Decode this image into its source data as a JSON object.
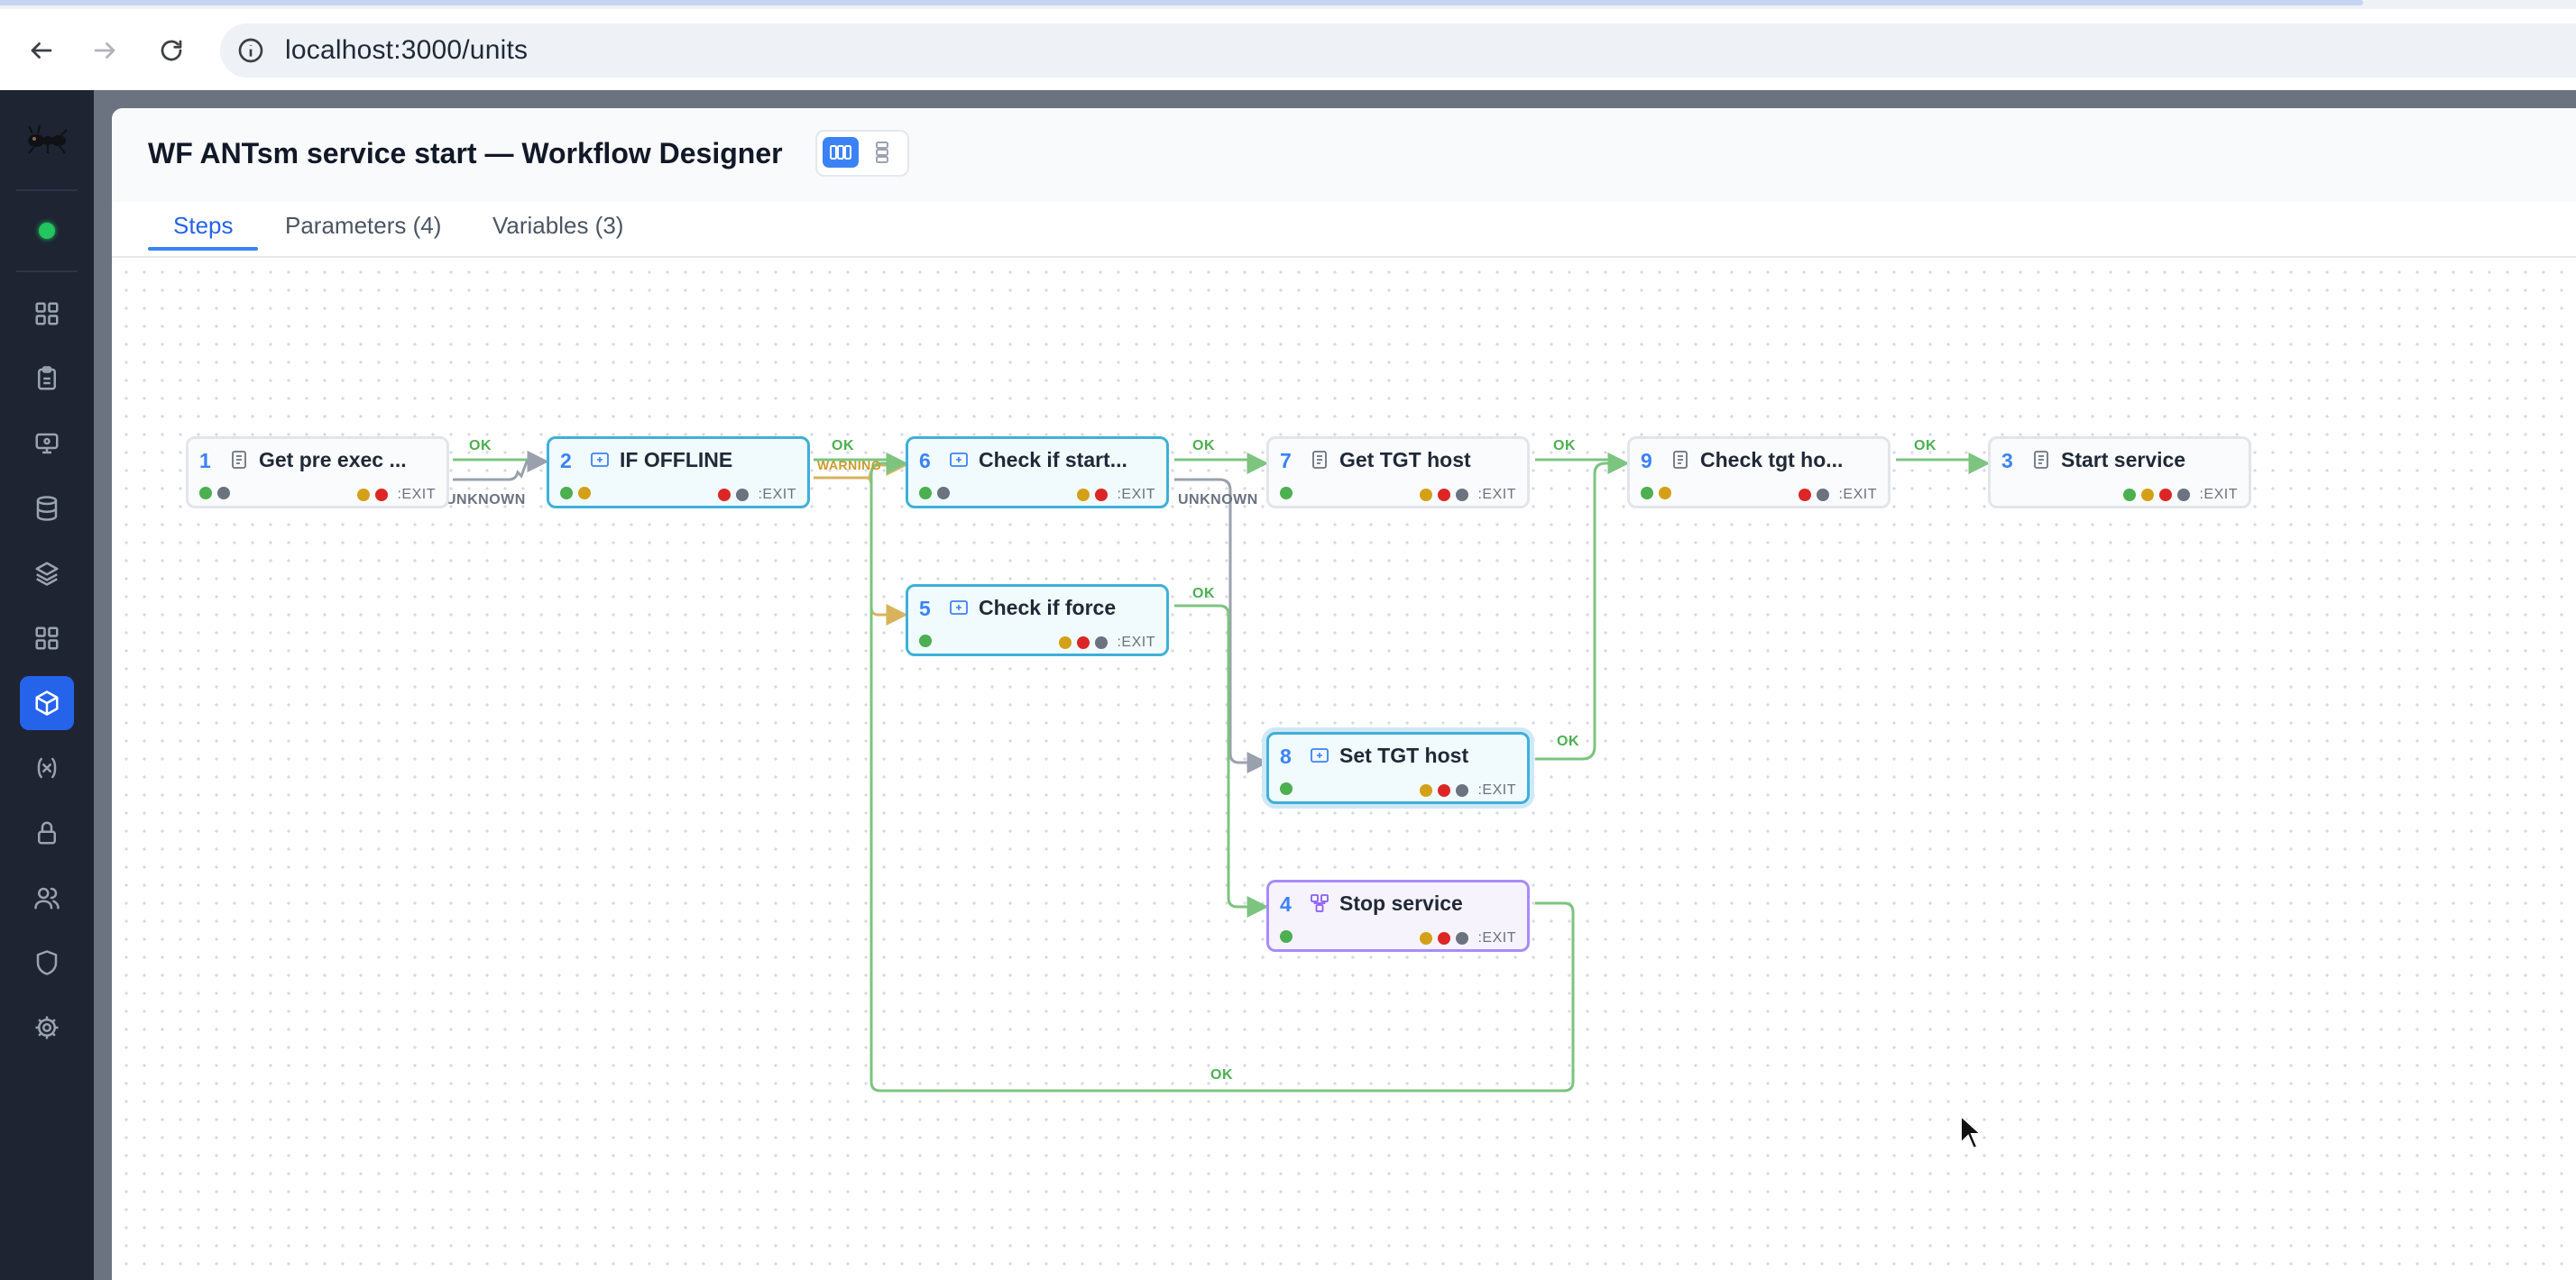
{
  "browser": {
    "url": "localhost:3000/units"
  },
  "header": {
    "title": "WF ANTsm service start — Workflow Designer"
  },
  "tabs": [
    {
      "label": "Steps",
      "active": true
    },
    {
      "label": "Parameters (4)",
      "active": false
    },
    {
      "label": "Variables (3)",
      "active": false
    }
  ],
  "sidebar": {
    "status": "online",
    "items": [
      "dashboard-icon",
      "clipboard-icon",
      "monitor-icon",
      "database-icon",
      "layers-icon",
      "grid-icon",
      "cube-icon",
      "variable-icon",
      "lock-icon",
      "users-icon",
      "shield-icon",
      "gear-icon"
    ],
    "active_item": "cube-icon"
  },
  "colors": {
    "ok": "#4caf50",
    "warning": "#d4a017",
    "error": "#dc2626",
    "unknown": "#6b7280",
    "exit": "#6b7280",
    "accent": "#3b82f6"
  },
  "nodes": [
    {
      "num": "1",
      "label": "Get pre exec ...",
      "type": "script",
      "inputs": [
        "ok",
        "unknown"
      ],
      "outputs": [
        "warning",
        "error"
      ],
      "exit": ":EXIT"
    },
    {
      "num": "2",
      "label": "IF OFFLINE",
      "type": "condition",
      "inputs": [
        "ok",
        "warning"
      ],
      "outputs": [
        "error",
        "unknown"
      ],
      "exit": ":EXIT"
    },
    {
      "num": "6",
      "label": "Check if start...",
      "type": "condition",
      "inputs": [
        "ok",
        "unknown"
      ],
      "outputs": [
        "warning",
        "error"
      ],
      "exit": ":EXIT"
    },
    {
      "num": "7",
      "label": "Get TGT host",
      "type": "script",
      "inputs": [
        "ok"
      ],
      "outputs": [
        "warning",
        "error",
        "unknown"
      ],
      "exit": ":EXIT"
    },
    {
      "num": "9",
      "label": "Check tgt ho...",
      "type": "script",
      "inputs": [
        "ok",
        "warning"
      ],
      "outputs": [
        "error",
        "unknown"
      ],
      "exit": ":EXIT"
    },
    {
      "num": "3",
      "label": "Start service",
      "type": "script",
      "inputs": [],
      "outputs": [
        "ok",
        "warning",
        "error",
        "unknown"
      ],
      "exit": ":EXIT"
    },
    {
      "num": "5",
      "label": "Check if force",
      "type": "condition",
      "inputs": [
        "ok"
      ],
      "outputs": [
        "warning",
        "error",
        "unknown"
      ],
      "exit": ":EXIT"
    },
    {
      "num": "8",
      "label": "Set TGT host",
      "type": "condition",
      "inputs": [
        "ok"
      ],
      "outputs": [
        "warning",
        "error",
        "unknown"
      ],
      "exit": ":EXIT"
    },
    {
      "num": "4",
      "label": "Stop service",
      "type": "workflow",
      "inputs": [
        "ok"
      ],
      "outputs": [
        "warning",
        "error",
        "unknown"
      ],
      "exit": ":EXIT"
    }
  ],
  "edges": [
    {
      "from": "1",
      "to": "2",
      "label": "OK",
      "kind": "ok"
    },
    {
      "from": "1",
      "to": "2",
      "label": "UNKNOWN",
      "kind": "unknown"
    },
    {
      "from": "2",
      "to": "6",
      "label": "OK",
      "kind": "ok"
    },
    {
      "from": "2",
      "to": "6",
      "label": "WARNING",
      "kind": "warning"
    },
    {
      "from": "2",
      "to": "5",
      "label": "",
      "kind": "warning"
    },
    {
      "from": "6",
      "to": "7",
      "label": "OK",
      "kind": "ok"
    },
    {
      "from": "6",
      "to": "8",
      "label": "UNKNOWN",
      "kind": "unknown"
    },
    {
      "from": "5",
      "to": "4",
      "label": "OK",
      "kind": "ok"
    },
    {
      "from": "7",
      "to": "9",
      "label": "OK",
      "kind": "ok"
    },
    {
      "from": "8",
      "to": "9",
      "label": "OK",
      "kind": "ok"
    },
    {
      "from": "9",
      "to": "3",
      "label": "OK",
      "kind": "ok"
    },
    {
      "from": "4",
      "to": "6",
      "label": "OK",
      "kind": "ok"
    }
  ]
}
